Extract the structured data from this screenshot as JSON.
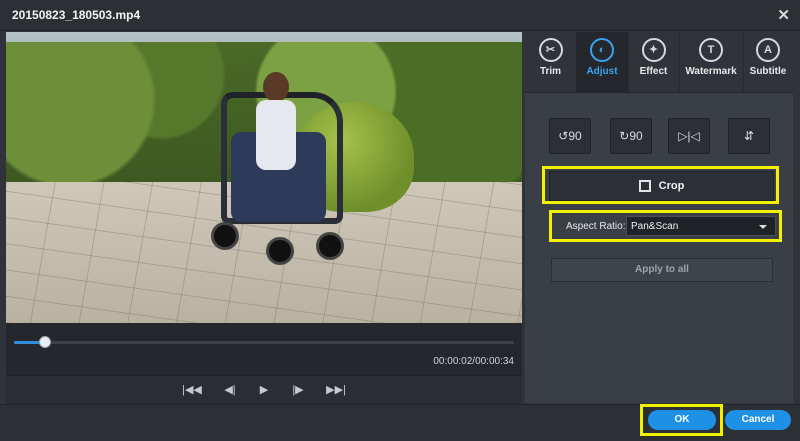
{
  "window": {
    "title": "20150823_180503.mp4",
    "close_icon": "close-icon"
  },
  "player": {
    "progress": 0.06,
    "timecode": "00:00:02/00:00:34",
    "controls": [
      {
        "name": "skip-to-start",
        "icon": "|◀◀"
      },
      {
        "name": "previous-frame",
        "icon": "◀|"
      },
      {
        "name": "play",
        "icon": "▶"
      },
      {
        "name": "next-frame",
        "icon": "|▶"
      },
      {
        "name": "skip-to-end",
        "icon": "▶▶|"
      }
    ]
  },
  "tabs": [
    {
      "label": "Trim",
      "icon": "scissors-icon",
      "glyph": "✂",
      "active": false
    },
    {
      "label": "Adjust",
      "icon": "adjust-icon",
      "glyph": "◐",
      "active": true
    },
    {
      "label": "Effect",
      "icon": "magic-wand-icon",
      "glyph": "✦",
      "active": false
    },
    {
      "label": "Watermark",
      "icon": "watermark-icon",
      "glyph": "T",
      "active": false
    },
    {
      "label": "Subtitle",
      "icon": "subtitle-icon",
      "glyph": "A",
      "active": false
    }
  ],
  "rotate_buttons": [
    {
      "name": "rotate-left-90",
      "glyph": "↺90"
    },
    {
      "name": "rotate-right-90",
      "glyph": "↻90"
    },
    {
      "name": "flip-horizontal",
      "glyph": "▷|◁"
    },
    {
      "name": "flip-vertical",
      "glyph": "⇵"
    }
  ],
  "crop": {
    "label": "Crop"
  },
  "aspect_ratio": {
    "label": "Aspect Ratio:",
    "value": "Pan&Scan"
  },
  "apply_to_all": {
    "label": "Apply to all"
  },
  "footer": {
    "ok_label": "OK",
    "cancel_label": "Cancel"
  },
  "colors": {
    "accent": "#1e90e6",
    "highlight": "#f2f200",
    "active_tab": "#39a3f0"
  }
}
